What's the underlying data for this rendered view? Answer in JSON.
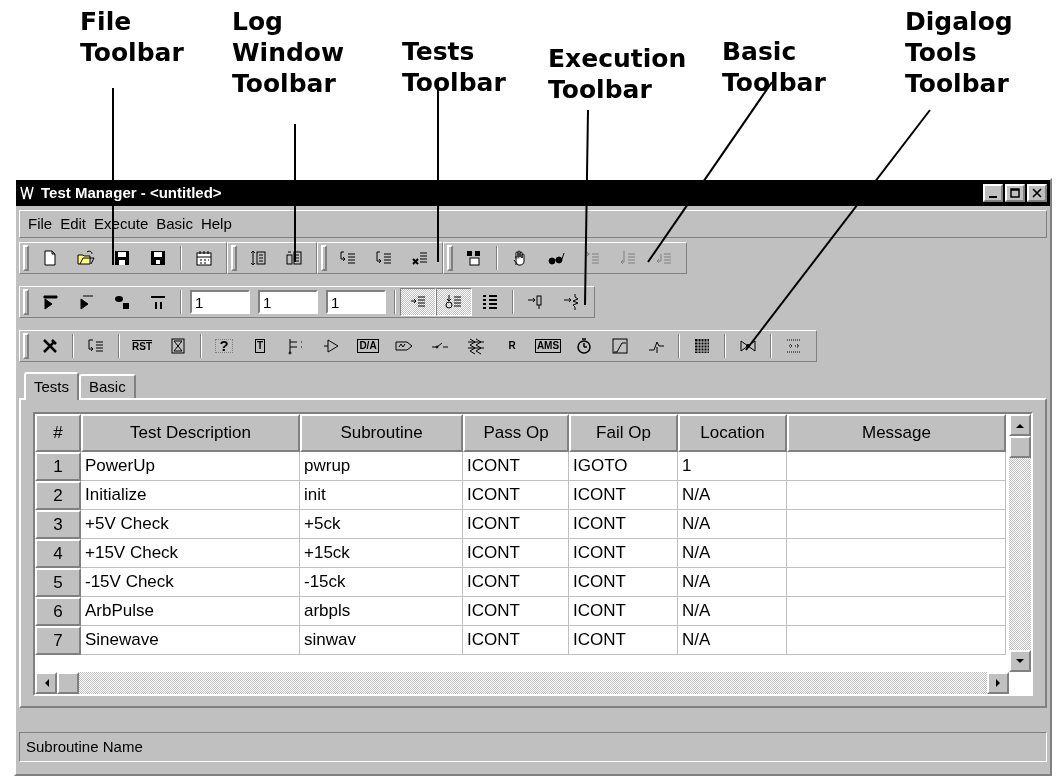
{
  "callouts": [
    {
      "lines": [
        "File",
        "Toolbar"
      ]
    },
    {
      "lines": [
        "Log",
        "Window",
        "Toolbar"
      ]
    },
    {
      "lines": [
        "Tests",
        "Toolbar"
      ]
    },
    {
      "lines": [
        "Execution",
        "Toolbar"
      ]
    },
    {
      "lines": [
        "Basic",
        "Toolbar"
      ]
    },
    {
      "lines": [
        "Digalog",
        "Tools",
        "Toolbar"
      ]
    }
  ],
  "window": {
    "title": "Test Manager - <untitled>"
  },
  "menu": [
    {
      "label": "File"
    },
    {
      "label": "Edit"
    },
    {
      "label": "Execute"
    },
    {
      "label": "Basic"
    },
    {
      "label": "Help"
    }
  ],
  "toolbar_rows": [
    {
      "toolbars": [
        {
          "groups": [
            [
              {
                "kind": "button",
                "disabled": false,
                "pressed": false
              },
              {
                "kind": "button",
                "disabled": false,
                "pressed": false
              },
              {
                "kind": "button",
                "disabled": false,
                "pressed": false
              },
              {
                "kind": "button",
                "disabled": false,
                "pressed": false
              }
            ],
            [
              {
                "kind": "button",
                "disabled": false,
                "pressed": false
              }
            ]
          ]
        },
        {
          "groups": [
            [
              {
                "kind": "button",
                "disabled": false,
                "pressed": false
              },
              {
                "kind": "button",
                "disabled": false,
                "pressed": false
              }
            ]
          ]
        },
        {
          "groups": [
            [
              {
                "kind": "button",
                "disabled": false,
                "pressed": false
              },
              {
                "kind": "button",
                "disabled": false,
                "pressed": false
              },
              {
                "kind": "button",
                "disabled": false,
                "pressed": false
              }
            ]
          ]
        },
        {
          "groups": [
            [
              {
                "kind": "button",
                "disabled": false,
                "pressed": false
              }
            ],
            [
              {
                "kind": "button",
                "disabled": false,
                "pressed": false
              },
              {
                "kind": "button",
                "disabled": false,
                "pressed": false
              },
              {
                "kind": "button",
                "disabled": true,
                "pressed": false
              },
              {
                "kind": "button",
                "disabled": true,
                "pressed": false
              },
              {
                "kind": "button",
                "disabled": true,
                "pressed": false
              }
            ]
          ]
        }
      ]
    },
    {
      "toolbars": [
        {
          "groups": [
            [
              {
                "kind": "button",
                "disabled": false,
                "pressed": false
              },
              {
                "kind": "button",
                "disabled": false,
                "pressed": false
              },
              {
                "kind": "button",
                "disabled": false,
                "pressed": false
              },
              {
                "kind": "button",
                "disabled": false,
                "pressed": false
              }
            ],
            [
              {
                "kind": "field",
                "value": "1"
              },
              {
                "kind": "field",
                "value": "1"
              },
              {
                "kind": "field",
                "value": "1"
              }
            ],
            [
              {
                "kind": "button",
                "disabled": false,
                "pressed": true
              },
              {
                "kind": "button",
                "disabled": false,
                "pressed": true
              },
              {
                "kind": "button",
                "disabled": false,
                "pressed": false
              }
            ],
            [
              {
                "kind": "button",
                "disabled": false,
                "pressed": false
              },
              {
                "kind": "button",
                "disabled": false,
                "pressed": false
              }
            ]
          ]
        }
      ]
    },
    {
      "toolbars": [
        {
          "groups": [
            [
              {
                "kind": "button",
                "disabled": false,
                "pressed": false
              }
            ],
            [
              {
                "kind": "button",
                "disabled": false,
                "pressed": false
              }
            ],
            [
              {
                "kind": "button",
                "label": "RST",
                "disabled": false,
                "pressed": false
              },
              {
                "kind": "button",
                "disabled": false,
                "pressed": false
              }
            ],
            [
              {
                "kind": "button",
                "label": "?",
                "disabled": false,
                "pressed": false
              },
              {
                "kind": "button",
                "label": "T",
                "disabled": false,
                "pressed": false
              },
              {
                "kind": "button",
                "disabled": false,
                "pressed": false
              },
              {
                "kind": "button",
                "disabled": false,
                "pressed": false
              },
              {
                "kind": "button",
                "label": "D/A",
                "disabled": false,
                "pressed": false
              },
              {
                "kind": "button",
                "disabled": false,
                "pressed": false
              },
              {
                "kind": "button",
                "disabled": false,
                "pressed": false
              },
              {
                "kind": "button",
                "disabled": false,
                "pressed": false
              },
              {
                "kind": "button",
                "label": "R",
                "disabled": false,
                "pressed": false
              },
              {
                "kind": "button",
                "label": "AMS",
                "disabled": false,
                "pressed": false
              },
              {
                "kind": "button",
                "disabled": false,
                "pressed": false
              },
              {
                "kind": "button",
                "disabled": false,
                "pressed": false
              },
              {
                "kind": "button",
                "disabled": false,
                "pressed": false
              }
            ],
            [
              {
                "kind": "button",
                "disabled": false,
                "pressed": false
              }
            ],
            [
              {
                "kind": "button",
                "disabled": false,
                "pressed": false
              }
            ],
            [
              {
                "kind": "button",
                "disabled": false,
                "pressed": false
              }
            ]
          ]
        }
      ]
    }
  ],
  "tabs": [
    {
      "label": "Tests",
      "selected": true
    },
    {
      "label": "Basic",
      "selected": false
    }
  ],
  "table": {
    "columns": [
      "#",
      "Test Description",
      "Subroutine",
      "Pass Op",
      "Fail Op",
      "Location",
      "Message"
    ],
    "rows": [
      [
        "1",
        "PowerUp",
        "pwrup",
        "ICONT",
        "IGOTO",
        "1",
        ""
      ],
      [
        "2",
        "Initialize",
        "init",
        "ICONT",
        "ICONT",
        "N/A",
        ""
      ],
      [
        "3",
        "+5V Check",
        "+5ck",
        "ICONT",
        "ICONT",
        "N/A",
        ""
      ],
      [
        "4",
        "+15V Check",
        "+15ck",
        "ICONT",
        "ICONT",
        "N/A",
        ""
      ],
      [
        "5",
        "-15V Check",
        "-15ck",
        "ICONT",
        "ICONT",
        "N/A",
        ""
      ],
      [
        "6",
        "ArbPulse",
        "arbpls",
        "ICONT",
        "ICONT",
        "N/A",
        ""
      ],
      [
        "7",
        "Sinewave",
        "sinwav",
        "ICONT",
        "ICONT",
        "N/A",
        ""
      ]
    ]
  },
  "status_bar": "Subroutine Name"
}
